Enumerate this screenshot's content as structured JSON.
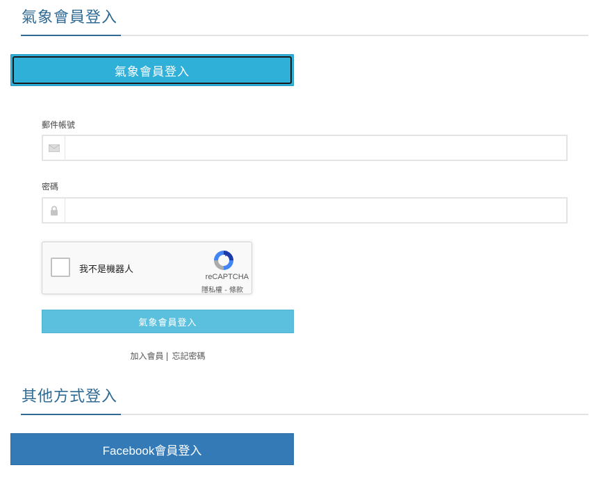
{
  "login_section": {
    "title": "氣象會員登入"
  },
  "login_tab": {
    "label": "氣象會員登入"
  },
  "email": {
    "label": "郵件帳號",
    "value": "",
    "icon": "envelope-icon"
  },
  "password": {
    "label": "密碼",
    "value": "",
    "icon": "lock-icon"
  },
  "captcha": {
    "checkbox_label": "我不是機器人",
    "brand": "reCAPTCHA",
    "privacy": "隱私權",
    "separator": "-",
    "terms": "條款"
  },
  "submit": {
    "label": "氣象會員登入"
  },
  "links": {
    "join": "加入會員",
    "separator": "|",
    "forgot": "忘記密碼"
  },
  "other_section": {
    "title": "其他方式登入"
  },
  "facebook": {
    "label": "Facebook會員登入"
  },
  "colors": {
    "accent": "#2f6a94",
    "tab_button": "#2eb0d9",
    "submit_button": "#5bc0de",
    "facebook_button": "#337ab7"
  }
}
